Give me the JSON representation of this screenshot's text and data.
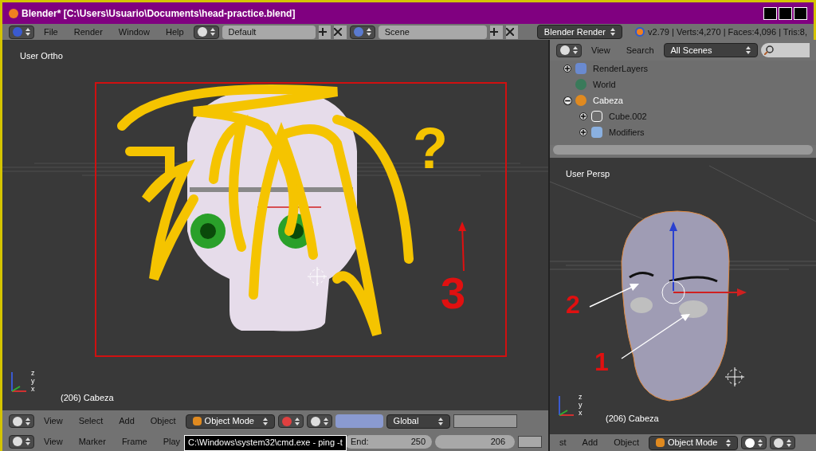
{
  "window": {
    "title": "Blender* [C:\\Users\\Usuario\\Documents\\head-practice.blend]"
  },
  "info_header": {
    "menus": [
      "File",
      "Render",
      "Window",
      "Help"
    ],
    "layout": "Default",
    "scene": "Scene",
    "engine": "Blender Render",
    "stats": "v2.79 | Verts:4,270 | Faces:4,096 | Tris:8,"
  },
  "left_viewport": {
    "view_label": "User Ortho",
    "object_label": "(206) Cabeza",
    "axis_labels": [
      "z",
      "y",
      "x"
    ],
    "annotations": [
      "?",
      "3"
    ]
  },
  "outliner": {
    "menus": [
      "View",
      "Search"
    ],
    "filter": "All Scenes",
    "items": [
      {
        "label": "RenderLayers",
        "kind": "renderlayers",
        "expanded": false,
        "selected": false
      },
      {
        "label": "World",
        "kind": "world",
        "selected": false
      },
      {
        "label": "Cabeza",
        "kind": "object",
        "expanded": true,
        "selected": true,
        "children": [
          {
            "label": "Cube.002",
            "kind": "mesh",
            "expanded": false,
            "selected": false
          },
          {
            "label": "Modifiers",
            "kind": "modifiers",
            "expanded": false,
            "selected": false
          }
        ]
      }
    ]
  },
  "right_viewport": {
    "view_label": "User Persp",
    "object_label": "(206) Cabeza",
    "axis_labels": [
      "z",
      "y",
      "x"
    ],
    "annotations": [
      "2",
      "1"
    ]
  },
  "left_header": {
    "menus": [
      "View",
      "Select",
      "Add",
      "Object"
    ],
    "mode": "Object Mode",
    "orientation": "Global"
  },
  "timeline": {
    "menus": [
      "View",
      "Marker",
      "Frame",
      "Play"
    ],
    "end_label": "End:",
    "end_value": "250",
    "current_frame": "206"
  },
  "cmd_tooltip": "C:\\Windows\\system32\\cmd.exe - ping -t",
  "right_header": {
    "menus": [
      "st",
      "Add",
      "Object"
    ],
    "mode": "Object Mode"
  }
}
